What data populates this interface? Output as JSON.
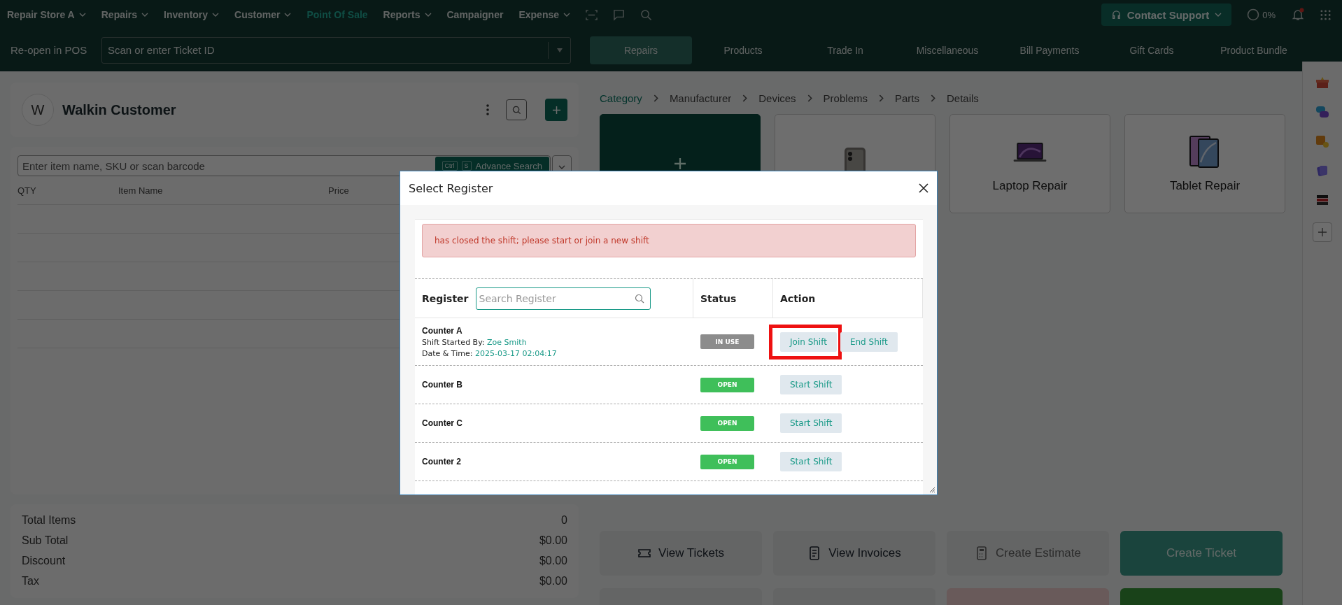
{
  "nav": {
    "store": "Repair Store A",
    "items": [
      {
        "label": "Repairs",
        "dropdown": true,
        "selected": false
      },
      {
        "label": "Inventory",
        "dropdown": true,
        "selected": false
      },
      {
        "label": "Customer",
        "dropdown": true,
        "selected": false
      },
      {
        "label": "Point Of Sale",
        "dropdown": false,
        "selected": true
      },
      {
        "label": "Reports",
        "dropdown": true,
        "selected": false
      },
      {
        "label": "Campaigner",
        "dropdown": false,
        "selected": false
      },
      {
        "label": "Expense",
        "dropdown": true,
        "selected": false
      }
    ],
    "support": "Contact Support",
    "progress": "0%",
    "notification": true
  },
  "subbar": {
    "label": "Re-open in POS",
    "ticket_placeholder": "Scan or enter Ticket ID",
    "tabs": [
      {
        "label": "Repairs",
        "selected": true
      },
      {
        "label": "Products",
        "selected": false
      },
      {
        "label": "Trade In",
        "selected": false
      },
      {
        "label": "Miscellaneous",
        "selected": false
      },
      {
        "label": "Bill Payments",
        "selected": false
      },
      {
        "label": "Gift Cards",
        "selected": false
      },
      {
        "label": "Product Bundle",
        "selected": false
      }
    ]
  },
  "customer": {
    "initial": "W",
    "name": "Walkin Customer"
  },
  "cart": {
    "placeholder": "Enter item name, SKU or scan barcode",
    "keys": [
      "Ctrl",
      "S"
    ],
    "advance": "Advance Search",
    "columns": [
      "QTY",
      "Item Name",
      "Price"
    ]
  },
  "totals": [
    {
      "label": "Total Items",
      "value": "0"
    },
    {
      "label": "Sub Total",
      "value": "$0.00"
    },
    {
      "label": "Discount",
      "value": "$0.00"
    },
    {
      "label": "Tax",
      "value": "$0.00"
    }
  ],
  "breadcrumb": [
    {
      "label": "Category",
      "selected": true
    },
    {
      "label": "Manufacturer",
      "selected": false
    },
    {
      "label": "Devices",
      "selected": false
    },
    {
      "label": "Problems",
      "selected": false
    },
    {
      "label": "Parts",
      "selected": false
    },
    {
      "label": "Details",
      "selected": false
    }
  ],
  "categories": [
    {
      "kind": "add"
    },
    {
      "kind": "phone"
    },
    {
      "kind": "laptop",
      "label": "Laptop Repair"
    },
    {
      "kind": "tablet",
      "label": "Tablet Repair"
    }
  ],
  "actions": [
    {
      "kind": "plain",
      "label": "View Tickets"
    },
    {
      "kind": "plain",
      "label": "View Invoices"
    },
    {
      "kind": "muted",
      "label": "Create Estimate"
    },
    {
      "kind": "primary",
      "label": "Create Ticket"
    },
    {
      "kind": "plain"
    },
    {
      "kind": "plain"
    },
    {
      "kind": "danger"
    },
    {
      "kind": "success"
    }
  ],
  "modal": {
    "title": "Select Register",
    "alert": "has closed the shift; please start or join a new shift",
    "columns": {
      "register": "Register",
      "search_placeholder": "Search Register",
      "status": "Status",
      "action": "Action"
    },
    "rows": [
      {
        "name": "Counter A",
        "started_label": "Shift Started By:",
        "started_by": "Zoe Smith",
        "time_label": "Date & Time:",
        "time": "2025-03-17 02:04:17",
        "status": {
          "label": "IN USE",
          "kind": "in_use"
        },
        "buttons": [
          {
            "label": "Join Shift",
            "highlighted": true
          },
          {
            "label": "End Shift",
            "highlighted": false
          }
        ]
      },
      {
        "name": "Counter B",
        "status": {
          "label": "OPEN",
          "kind": "open"
        },
        "buttons": [
          {
            "label": "Start Shift",
            "highlighted": false
          }
        ]
      },
      {
        "name": "Counter C",
        "status": {
          "label": "OPEN",
          "kind": "open"
        },
        "buttons": [
          {
            "label": "Start Shift",
            "highlighted": false
          }
        ]
      },
      {
        "name": "Counter 2",
        "status": {
          "label": "OPEN",
          "kind": "open"
        },
        "buttons": [
          {
            "label": "Start Shift",
            "highlighted": false
          }
        ]
      }
    ]
  }
}
